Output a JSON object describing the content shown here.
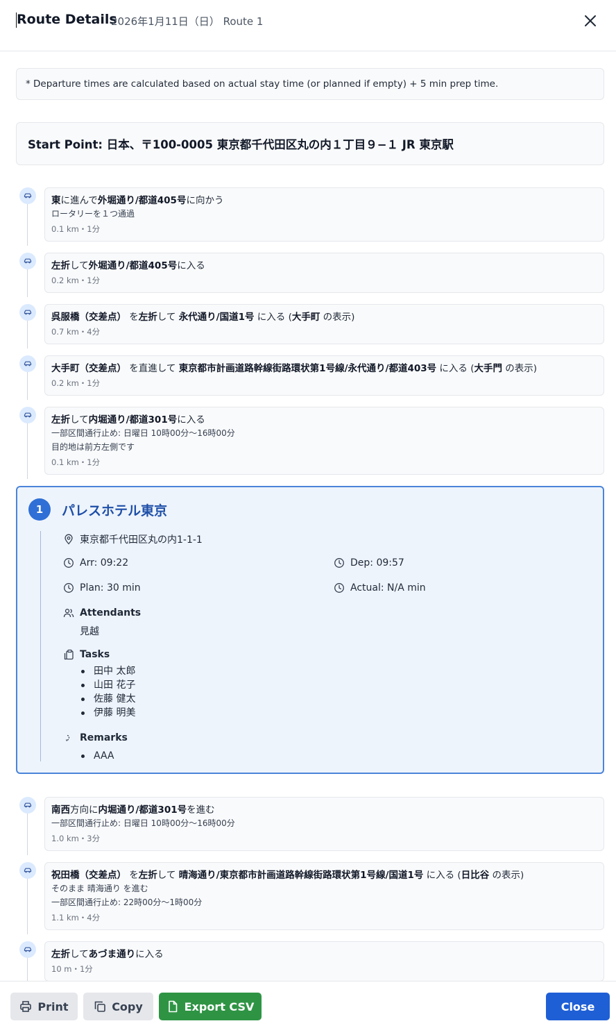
{
  "header": {
    "title": "Route Details",
    "subtitle": "2026年1月11日（日）  Route 1"
  },
  "notice": "* Departure times are calculated based on actual stay time (or planned if empty) + 5 min prep time.",
  "start_point": "Start Point: 日本、〒100-0005 東京都千代田区丸の内１丁目９−１ JR 東京駅",
  "steps_before": [
    {
      "parts": [
        [
          "b",
          "東"
        ],
        [
          "t",
          "に進んで"
        ],
        [
          "b",
          "外堀通り/都道405号"
        ],
        [
          "t",
          "に向かう"
        ]
      ],
      "sub": [
        "ロータリーを１つ通過"
      ],
      "dist": "0.1 km・1分"
    },
    {
      "parts": [
        [
          "b",
          "左折"
        ],
        [
          "t",
          "して"
        ],
        [
          "b",
          "外堀通り/都道405号"
        ],
        [
          "t",
          "に入る"
        ]
      ],
      "sub": [],
      "dist": "0.2 km・1分"
    },
    {
      "parts": [
        [
          "b",
          "呉服橋（交差点）"
        ],
        [
          "t",
          " を"
        ],
        [
          "b",
          "左折"
        ],
        [
          "t",
          "して "
        ],
        [
          "b",
          "永代通り/国道1号"
        ],
        [
          "t",
          " に入る ("
        ],
        [
          "b",
          "大手町"
        ],
        [
          "t",
          " の表示)"
        ]
      ],
      "sub": [],
      "dist": "0.7 km・4分"
    },
    {
      "parts": [
        [
          "b",
          "大手町（交差点）"
        ],
        [
          "t",
          " を直進して "
        ],
        [
          "b",
          "東京都市計画道路幹線街路環状第1号線/永代通り/都道403号"
        ],
        [
          "t",
          " に入る ("
        ],
        [
          "b",
          "大手門"
        ],
        [
          "t",
          " の表示)"
        ]
      ],
      "sub": [],
      "dist": "0.2 km・1分"
    },
    {
      "parts": [
        [
          "b",
          "左折"
        ],
        [
          "t",
          "して"
        ],
        [
          "b",
          "内堀通り/都道301号"
        ],
        [
          "t",
          "に入る"
        ]
      ],
      "sub": [
        "一部区間通行止め: 日曜日 10時00分〜16時00分",
        "目的地は前方左側です"
      ],
      "dist": "0.1 km・1分"
    }
  ],
  "stop": {
    "number": "1",
    "name": "パレスホテル東京",
    "address": "東京都千代田区丸の内1-1-1",
    "arrival": "Arr: 09:22",
    "departure": "Dep: 09:57",
    "plan": "Plan: 30 min",
    "actual": "Actual: N/A min",
    "attendants_label": "Attendants",
    "attendants": "見越",
    "tasks_label": "Tasks",
    "tasks": [
      "田中 太郎",
      "山田 花子",
      "佐藤 健太",
      "伊藤 明美"
    ],
    "remarks_label": "Remarks",
    "remarks": [
      "AAA"
    ]
  },
  "steps_after": [
    {
      "parts": [
        [
          "b",
          "南西"
        ],
        [
          "t",
          "方向に"
        ],
        [
          "b",
          "内堀通り/都道301号"
        ],
        [
          "t",
          "を進む"
        ]
      ],
      "sub": [
        "一部区間通行止め: 日曜日 10時00分〜16時00分"
      ],
      "dist": "1.0 km・3分"
    },
    {
      "parts": [
        [
          "b",
          "祝田橋（交差点）"
        ],
        [
          "t",
          " を"
        ],
        [
          "b",
          "左折"
        ],
        [
          "t",
          "して "
        ],
        [
          "b",
          "晴海通り/東京都市計画道路幹線街路環状第1号線/国道1号"
        ],
        [
          "t",
          " に入る ("
        ],
        [
          "b",
          "日比谷"
        ],
        [
          "t",
          " の表示)"
        ]
      ],
      "sub": [
        "そのまま 晴海通り を進む",
        "一部区間通行止め: 22時00分〜1時00分"
      ],
      "dist": "1.1 km・4分"
    },
    {
      "parts": [
        [
          "b",
          "左折"
        ],
        [
          "t",
          "して"
        ],
        [
          "b",
          "あづま通り"
        ],
        [
          "t",
          "に入る"
        ]
      ],
      "sub": [],
      "dist": "10 m・1分"
    }
  ],
  "footer": {
    "print_label": "Print",
    "copy_label": "Copy",
    "export_label": "Export CSV",
    "close_label": "Close"
  },
  "colors": {
    "accent": "#2f6fd6",
    "stop_border": "#4a84d9",
    "stop_bg": "#eef4fc",
    "export_green": "#2e9444",
    "close_blue": "#1f5fd6"
  },
  "icons": {
    "step": "car-icon",
    "address": "map-pin-icon",
    "time": "clock-icon",
    "attendants": "users-icon",
    "tasks": "clipboard-icon",
    "remarks": "note-icon",
    "print": "printer-icon",
    "copy": "copy-icon",
    "export": "file-icon"
  }
}
